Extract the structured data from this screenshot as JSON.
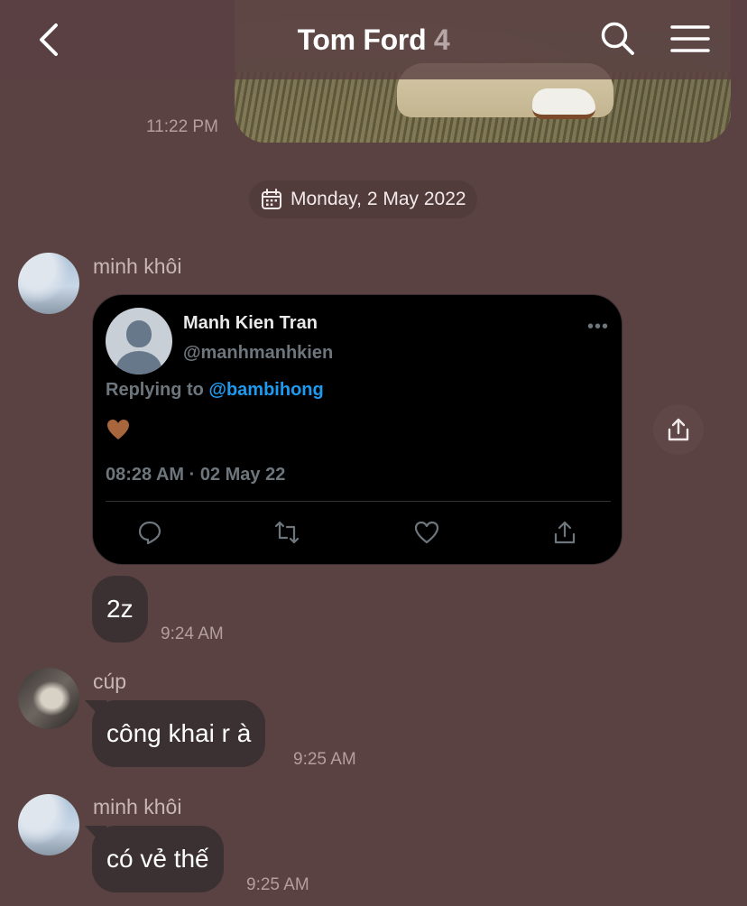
{
  "header": {
    "title": "Tom Ford",
    "member_count": "4",
    "back_icon": "chevron-left-icon",
    "search_icon": "search-icon",
    "menu_icon": "hamburger-menu-icon"
  },
  "top_message": {
    "time": "11:22 PM"
  },
  "date_chip": {
    "icon": "calendar-icon",
    "label": "Monday, 2 May 2022"
  },
  "messages": [
    {
      "sender": "minh khôi",
      "tweet": {
        "name": "Manh Kien Tran",
        "handle": "@manhmanhkien",
        "replying_prefix": "Replying to",
        "replying_to": "@bambihong",
        "content_emoji": "brown-heart-icon",
        "timestamp": "08:28 AM · 02 May 22",
        "more": "•••",
        "actions": [
          "reply-icon",
          "retweet-icon",
          "like-icon",
          "share-icon"
        ]
      },
      "share_icon": "share-icon",
      "text": "2z",
      "time": "9:24 AM"
    },
    {
      "sender": "cúp",
      "text": "công khai r à",
      "time": "9:25 AM"
    },
    {
      "sender": "minh khôi",
      "text": "có vẻ thế",
      "time": "9:25 AM"
    }
  ],
  "colors": {
    "background": "#5a4142",
    "bubble": "#3b3132",
    "timestamp": "#b49e9f",
    "tweet_bg": "#000000",
    "mention": "#1d9bf0"
  }
}
